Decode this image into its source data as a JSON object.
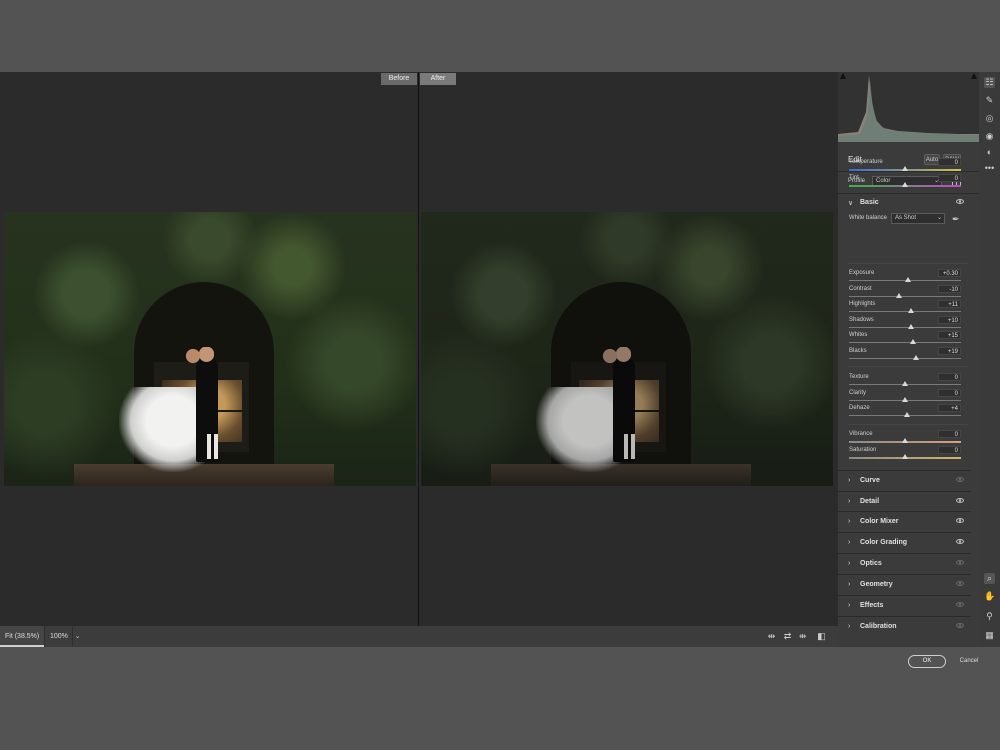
{
  "preview": {
    "before_label": "Before",
    "after_label": "After"
  },
  "bottom_bar": {
    "zoom_fit": "Fit (38.5%)",
    "zoom_100": "100%",
    "zoom_caret": "⌄",
    "icons": {
      "before_after_left_right": "⇹",
      "swap": "⇄",
      "copy_settings": "⇻",
      "toggle_view": "◧"
    }
  },
  "panel": {
    "edit_title": "Edit",
    "auto_label": "Auto",
    "bw_label": "B&W",
    "profile_label": "Profile",
    "profile_value": "Color",
    "basic": {
      "title": "Basic",
      "white_balance_label": "White balance",
      "white_balance_value": "As Shot",
      "sliders": [
        {
          "name": "Temperature",
          "value": "0",
          "position": 0.5,
          "track": "temp"
        },
        {
          "name": "Tint",
          "value": "0",
          "position": 0.5,
          "track": "tint"
        },
        {
          "name": "Exposure",
          "value": "+0.30",
          "position": 0.53,
          "track": "plain"
        },
        {
          "name": "Contrast",
          "value": "-10",
          "position": 0.45,
          "track": "plain"
        },
        {
          "name": "Highlights",
          "value": "+11",
          "position": 0.555,
          "track": "plain"
        },
        {
          "name": "Shadows",
          "value": "+10",
          "position": 0.55,
          "track": "plain"
        },
        {
          "name": "Whites",
          "value": "+15",
          "position": 0.575,
          "track": "plain"
        },
        {
          "name": "Blacks",
          "value": "+19",
          "position": 0.595,
          "track": "plain"
        },
        {
          "name": "Texture",
          "value": "0",
          "position": 0.5,
          "track": "plain"
        },
        {
          "name": "Clarity",
          "value": "0",
          "position": 0.5,
          "track": "plain"
        },
        {
          "name": "Dehaze",
          "value": "+4",
          "position": 0.52,
          "track": "plain"
        },
        {
          "name": "Vibrance",
          "value": "0",
          "position": 0.5,
          "track": "vib"
        },
        {
          "name": "Saturation",
          "value": "0",
          "position": 0.5,
          "track": "sat"
        }
      ]
    },
    "sections": [
      {
        "title": "Curve",
        "eye_dim": true
      },
      {
        "title": "Detail",
        "eye_dim": false
      },
      {
        "title": "Color Mixer",
        "eye_dim": false
      },
      {
        "title": "Color Grading",
        "eye_dim": false
      },
      {
        "title": "Optics",
        "eye_dim": true
      },
      {
        "title": "Geometry",
        "eye_dim": true
      },
      {
        "title": "Effects",
        "eye_dim": true
      },
      {
        "title": "Calibration",
        "eye_dim": true
      }
    ]
  },
  "toolstrip": {
    "top_tools": [
      {
        "name": "edit-sliders-icon",
        "glyph": "☷"
      },
      {
        "name": "healing-brush-icon",
        "glyph": "✎"
      },
      {
        "name": "masking-icon",
        "glyph": "◎"
      },
      {
        "name": "red-eye-icon",
        "glyph": "◉"
      },
      {
        "name": "presets-icon",
        "glyph": "◐"
      },
      {
        "name": "more-icon",
        "glyph": "•••"
      }
    ],
    "bottom_tools": [
      {
        "name": "zoom-icon",
        "glyph": "⌕"
      },
      {
        "name": "hand-icon",
        "glyph": "✋"
      },
      {
        "name": "color-sampler-icon",
        "glyph": "⚲"
      },
      {
        "name": "grid-overlay-icon",
        "glyph": "▦"
      }
    ]
  },
  "footer": {
    "ok_label": "OK",
    "cancel_label": "Cancel"
  }
}
